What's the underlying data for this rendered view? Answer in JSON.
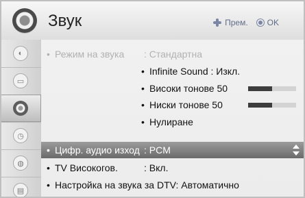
{
  "header": {
    "title": "Звук",
    "hints": {
      "move_label": "Прем.",
      "ok_label": "OK"
    }
  },
  "rail": {
    "items": [
      {
        "icon": "picture-icon",
        "active": false
      },
      {
        "icon": "screen-icon",
        "active": false
      },
      {
        "icon": "sound-icon",
        "active": true
      },
      {
        "icon": "time-icon",
        "active": false
      },
      {
        "icon": "lock-icon",
        "active": false
      },
      {
        "icon": "option-icon",
        "active": false
      }
    ]
  },
  "menu": {
    "sound_mode": {
      "bullet": "•",
      "label": "Режим на звука",
      "value": ": Стандартна"
    },
    "infinite_sound": {
      "bullet": "•",
      "text": "Infinite Sound : Изкл."
    },
    "treble": {
      "bullet": "•",
      "text": "Високи тонове  50",
      "level": 0.5
    },
    "bass": {
      "bullet": "•",
      "text": "Ниски тонове  50",
      "level": 0.5
    },
    "reset": {
      "bullet": "•",
      "text": "Нулиране"
    },
    "digital_audio_out": {
      "bullet": "•",
      "label": "Цифр. аудио изход",
      "value": ": PCM"
    },
    "tv_speaker": {
      "bullet": "•",
      "label": "TV Високогов.",
      "value": ": Вкл."
    },
    "dtv_sound": {
      "bullet": "•",
      "text": "Настройка на звука за DTV: Автоматично"
    }
  }
}
